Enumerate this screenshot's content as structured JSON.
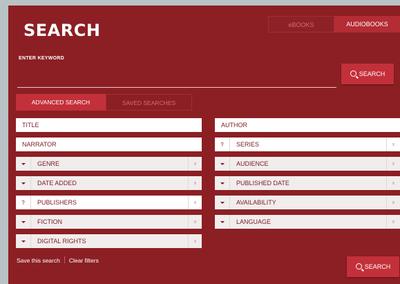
{
  "header": {
    "title": "SEARCH",
    "toggle": {
      "ebooks": "eBOOKS",
      "audiobooks": "AUDIOBOOKS",
      "selected": "audiobooks"
    }
  },
  "keyword": {
    "label": "ENTER KEYWORD",
    "value": "",
    "placeholder": ""
  },
  "search_button": "SEARCH",
  "tabs": {
    "advanced": "ADVANCED SEARCH",
    "saved": "SAVED SEARCHES",
    "selected": "advanced"
  },
  "fields": {
    "title": "TITLE",
    "author": "AUTHOR",
    "narrator": "NARRATOR",
    "series": "SERIES",
    "genre": "GENRE",
    "audience": "AUDIENCE",
    "date_added": "DATE ADDED",
    "published_date": "PUBLISHED DATE",
    "publishers": "PUBLISHERS",
    "availability": "AVAILABILITY",
    "fiction": "FICTION",
    "language": "LANGUAGE",
    "digital_rights": "DIGITAL RIGHTS"
  },
  "glyphs": {
    "help": "?",
    "clear": "x"
  },
  "footer_links": {
    "save": "Save this search",
    "clear": "Clear filters"
  },
  "colors": {
    "panel": "#8c1f24",
    "accent": "#c3303a"
  }
}
